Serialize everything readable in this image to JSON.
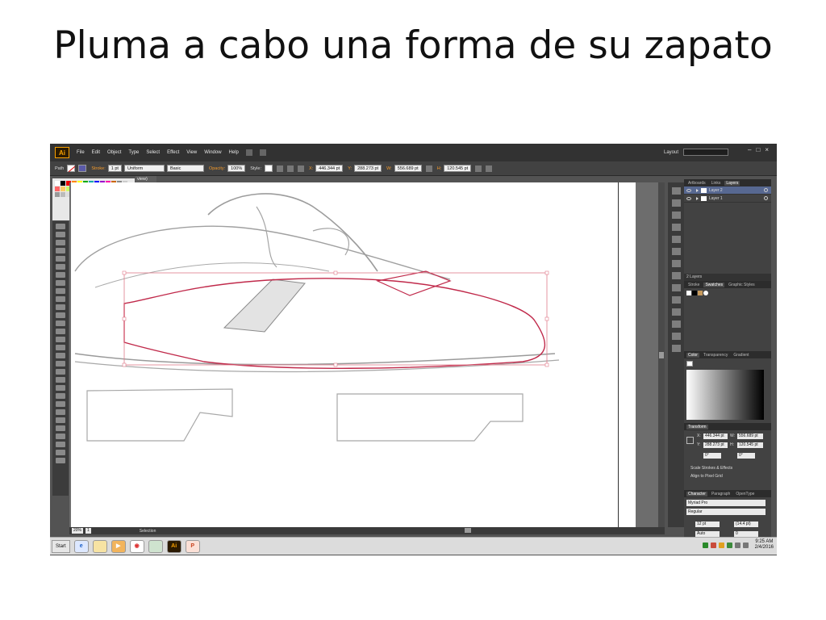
{
  "slide": {
    "title": "Pluma a cabo una forma de su zapato"
  },
  "app": {
    "logo": "Ai",
    "menu": [
      "File",
      "Edit",
      "Object",
      "Type",
      "Select",
      "Effect",
      "View",
      "Window",
      "Help"
    ],
    "layout_label": "Layout",
    "search_placeholder": "",
    "window_controls": [
      "–",
      "□",
      "×"
    ]
  },
  "control_bar": {
    "selection_type": "Path",
    "stroke_label": "Stroke:",
    "stroke_weight": "1 pt",
    "stroke_profile": "Uniform",
    "brush": "Basic",
    "opacity_label": "Opacity:",
    "opacity": "100%",
    "style_label": "Style:",
    "x_label": "X:",
    "x": "446.344 pt",
    "y_label": "Y:",
    "y": "288.273 pt",
    "w_label": "W:",
    "w": "556.689 pt",
    "h_label": "H:",
    "h": "120.545 pt"
  },
  "document": {
    "tab_label": "view)",
    "zoom": "20%",
    "page": "1",
    "status_text": "Selection"
  },
  "panels": {
    "layers_tabs": [
      "Artboards",
      "Links",
      "Layers"
    ],
    "layers": [
      {
        "name": "Layer 2",
        "selected": true
      },
      {
        "name": "Layer 1",
        "selected": false
      }
    ],
    "layers_count": "2 Layers",
    "swatch_tabs": [
      "Stroke",
      "Swatches",
      "Graphic Styles"
    ],
    "color_tabs": [
      "Color",
      "Transparency",
      "Gradient"
    ],
    "transform_tab": "Transform",
    "transform": {
      "x": "446.344 pt",
      "y": "288.273 pt",
      "w": "556.689 pt",
      "h": "120.545 pt",
      "rotate": "0°",
      "shear": "0°"
    },
    "transform_options": [
      "Scale Strokes & Effects",
      "Align to Pixel Grid"
    ],
    "char_tabs": [
      "Character",
      "Paragraph",
      "OpenType"
    ],
    "font_family": "Myriad Pro",
    "font_style": "Regular",
    "font_size": "12 pt",
    "leading": "(14.4 pt)",
    "kerning": "Auto",
    "tracking": "0"
  },
  "taskbar": {
    "start_label": "Start",
    "time": "9:25 AM",
    "date": "2/4/2016"
  },
  "colors": {
    "accent_orange": "#f39a2b",
    "selection_path": "#c0294a",
    "bbox": "#e07a8a",
    "layer_selected": "#576891"
  }
}
